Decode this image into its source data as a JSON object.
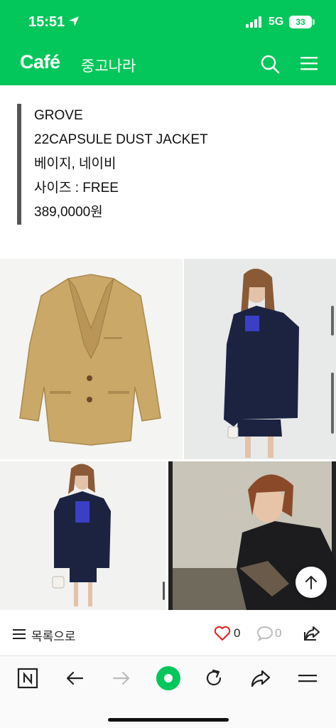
{
  "status_bar": {
    "time": "15:51",
    "network": "5G",
    "battery": "33"
  },
  "header": {
    "logo": "Café",
    "cafe_name": "중고나라"
  },
  "post": {
    "lines": [
      "GROVE",
      "22CAPSULE DUST JACKET",
      "베이지, 네이비",
      "사이즈 : FREE",
      "389,0000원"
    ]
  },
  "footer": {
    "list_label": "목록으로",
    "like_count": "0",
    "comment_count": "0"
  },
  "colors": {
    "brand": "#03c75a",
    "heart": "#e0211b",
    "jacket_beige": "#c9a868",
    "jacket_navy": "#1b2340"
  },
  "icons": [
    "location-arrow-icon",
    "signal-icon",
    "search-icon",
    "menu-icon",
    "list-icon",
    "heart-icon",
    "comment-icon",
    "share-icon",
    "naver-icon",
    "back-icon",
    "forward-icon",
    "green-dot-icon",
    "reload-icon",
    "browser-share-icon",
    "browser-menu-icon",
    "scroll-top-icon"
  ]
}
